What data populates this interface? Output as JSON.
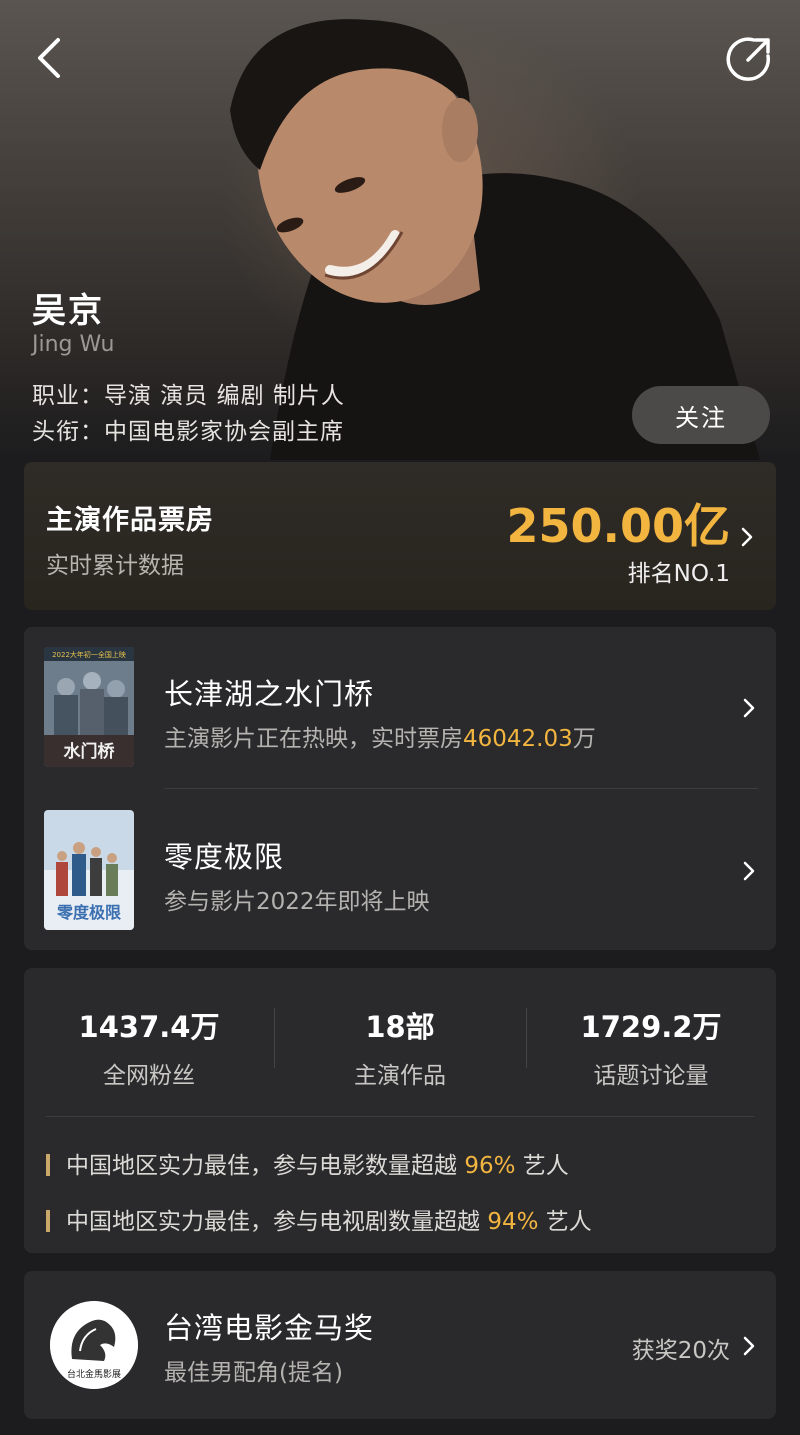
{
  "header": {
    "back_icon": "chevron-left-icon",
    "share_icon": "share-icon"
  },
  "profile": {
    "name": "吴京",
    "name_en": "Jing Wu",
    "occupation": "职业：导演 演员 编剧 制片人",
    "title": "头衔：中国电影家协会副主席",
    "follow_label": "关注"
  },
  "box_office": {
    "title": "主演作品票房",
    "subtitle": "实时累计数据",
    "value": "250.00亿",
    "rank": "排名NO.1"
  },
  "movies": [
    {
      "title": "长津湖之水门桥",
      "desc_prefix": "主演影片正在热映，实时票房",
      "desc_value": "46042.03",
      "desc_suffix": "万",
      "poster_text": "水门桥",
      "poster_banner": "2022大年初一全国上映"
    },
    {
      "title": "零度极限",
      "desc": "参与影片2022年即将上映",
      "poster_text": "零度极限"
    }
  ],
  "stats": [
    {
      "value": "1437.4万",
      "label": "全网粉丝"
    },
    {
      "value": "18部",
      "label": "主演作品"
    },
    {
      "value": "1729.2万",
      "label": "话题讨论量"
    }
  ],
  "notes": [
    {
      "prefix": "中国地区实力最佳，参与电影数量超越 ",
      "value": "96%",
      "suffix": " 艺人"
    },
    {
      "prefix": "中国地区实力最佳，参与电视剧数量超越 ",
      "value": "94%",
      "suffix": " 艺人"
    }
  ],
  "award": {
    "name": "台湾电影金马奖",
    "desc": "最佳男配角(提名)",
    "count": "获奖20次",
    "logo_text": "台北金馬影展"
  },
  "colors": {
    "accent": "#f2b540",
    "background": "#1c1c1e",
    "card": "#2a2a2c"
  }
}
